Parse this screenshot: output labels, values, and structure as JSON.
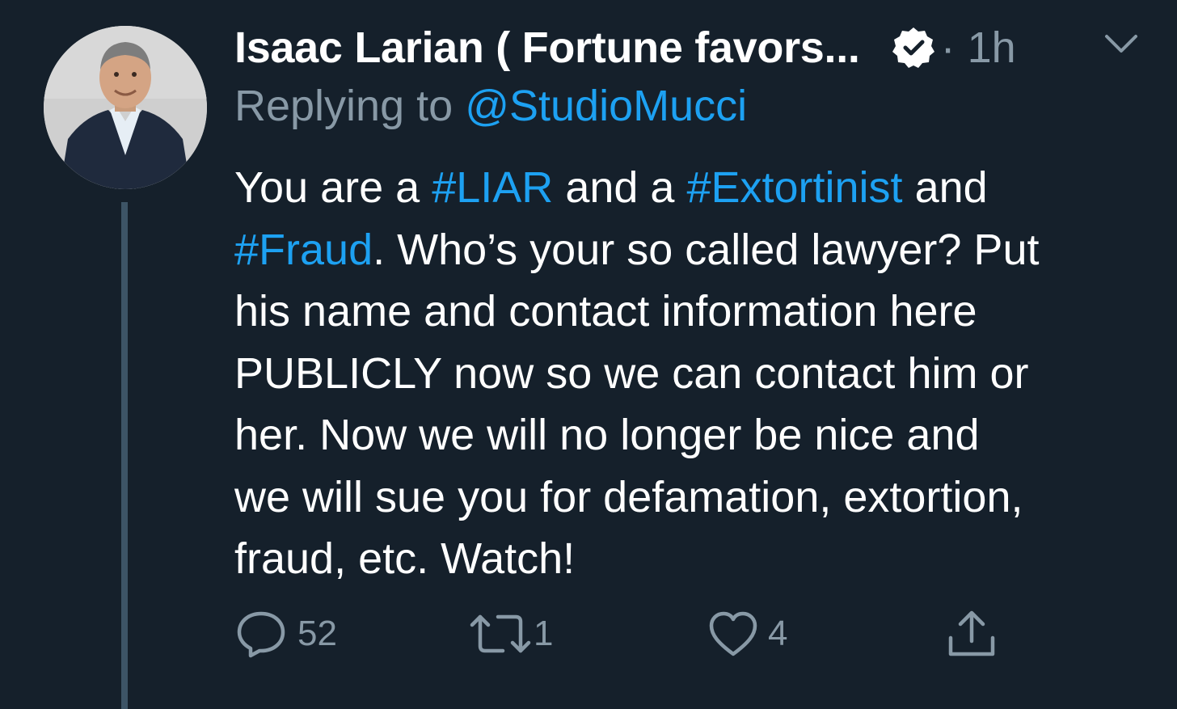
{
  "tweet": {
    "display_name": "Isaac Larian ( Fortune favors...",
    "time": "· 1h",
    "reply_prefix": "Replying to",
    "reply_handle": "@StudioMucci",
    "body": {
      "l1_a": "You are a ",
      "l1_tag1": "#LIAR",
      "l1_b": " and a ",
      "l1_tag2": "#Extortinist",
      "l1_c": " and",
      "l2_tag": "#Fraud",
      "l2_rest": ". Who’s your so called lawyer? Put",
      "l3": "his name and contact information here",
      "l4": "PUBLICLY now so we can contact him or",
      "l5": "her. Now we will no longer be nice and",
      "l6": "we will sue you for defamation, extortion,",
      "l7": "fraud, etc. Watch!"
    },
    "actions": {
      "reply_count": "52",
      "retweet_count": "1",
      "like_count": "4"
    }
  },
  "icons": {
    "verified": "verified-badge-icon",
    "caret": "chevron-down-icon",
    "reply": "reply-bubble-icon",
    "retweet": "retweet-icon",
    "like": "heart-icon",
    "share": "share-icon"
  },
  "colors": {
    "background": "#15202b",
    "text": "#ffffff",
    "secondary": "#8899a6",
    "link": "#1da1f2",
    "thread_line": "#3d5466"
  }
}
